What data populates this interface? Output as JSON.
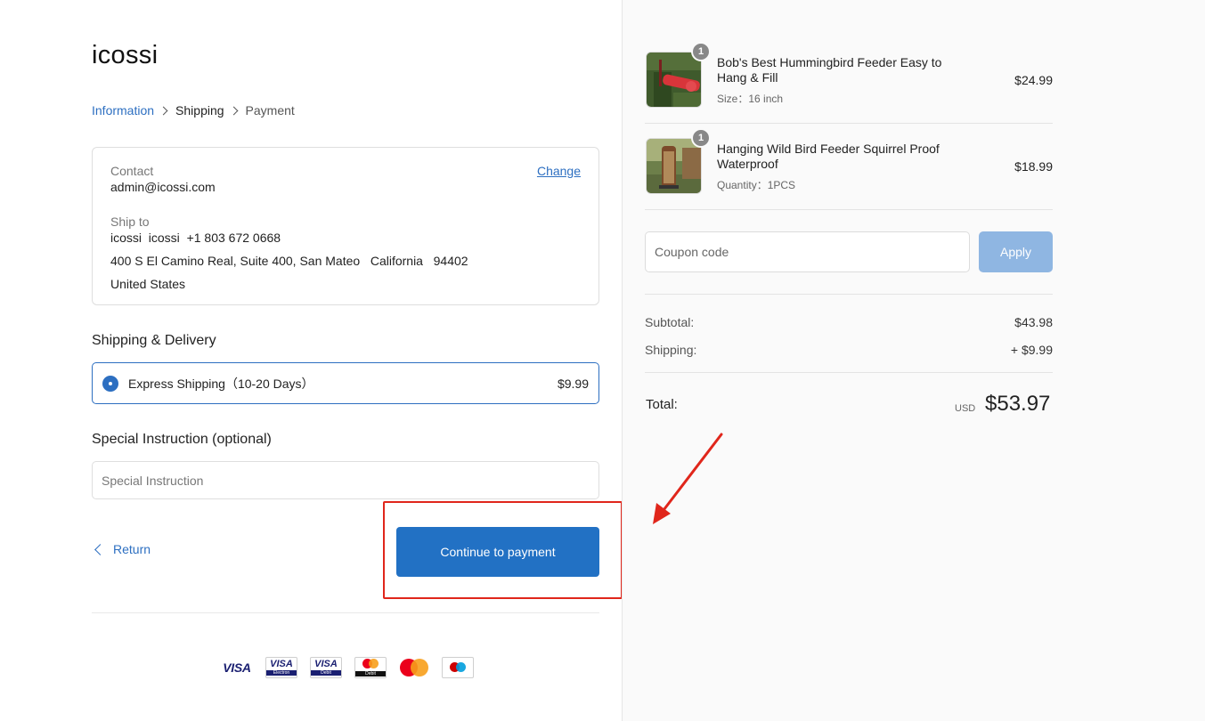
{
  "brand": "icossi",
  "breadcrumb": {
    "information": "Information",
    "shipping": "Shipping",
    "payment": "Payment"
  },
  "contact": {
    "label": "Contact",
    "value": "admin@icossi.com",
    "change": "Change"
  },
  "ship_to": {
    "label": "Ship to",
    "name_phone": "icossi  icossi  +1 803 672 0668",
    "address": "400 S El Camino Real, Suite 400, San Mateo   California   94402",
    "country": "United States"
  },
  "shipping_delivery": {
    "title": "Shipping & Delivery",
    "option_name": "Express Shipping（10-20 Days）",
    "option_price": "$9.99"
  },
  "special_instruction": {
    "title": "Special Instruction (optional)",
    "placeholder": "Special Instruction"
  },
  "actions": {
    "return": "Return",
    "continue": "Continue to payment"
  },
  "payment_methods": [
    "VISA",
    "VISA Electron",
    "VISA Debit",
    "Debit Mastercard",
    "Mastercard",
    "Maestro"
  ],
  "cart": {
    "items": [
      {
        "qty": "1",
        "title": "Bob's Best Hummingbird Feeder Easy to Hang & Fill",
        "meta": "Size：16 inch",
        "price": "$24.99"
      },
      {
        "qty": "1",
        "title": "Hanging Wild Bird Feeder Squirrel Proof Waterproof",
        "meta": "Quantity：1PCS",
        "price": "$18.99"
      }
    ],
    "coupon_placeholder": "Coupon code",
    "apply": "Apply",
    "subtotal_label": "Subtotal:",
    "subtotal": "$43.98",
    "shipping_label": "Shipping:",
    "shipping": "+ $9.99",
    "total_label": "Total:",
    "currency": "USD",
    "total": "$53.97"
  },
  "colors": {
    "accent": "#2271c4",
    "link": "#2d6fc1",
    "apply_disabled": "#8fb6e2",
    "annotation_red": "#e0261b"
  }
}
